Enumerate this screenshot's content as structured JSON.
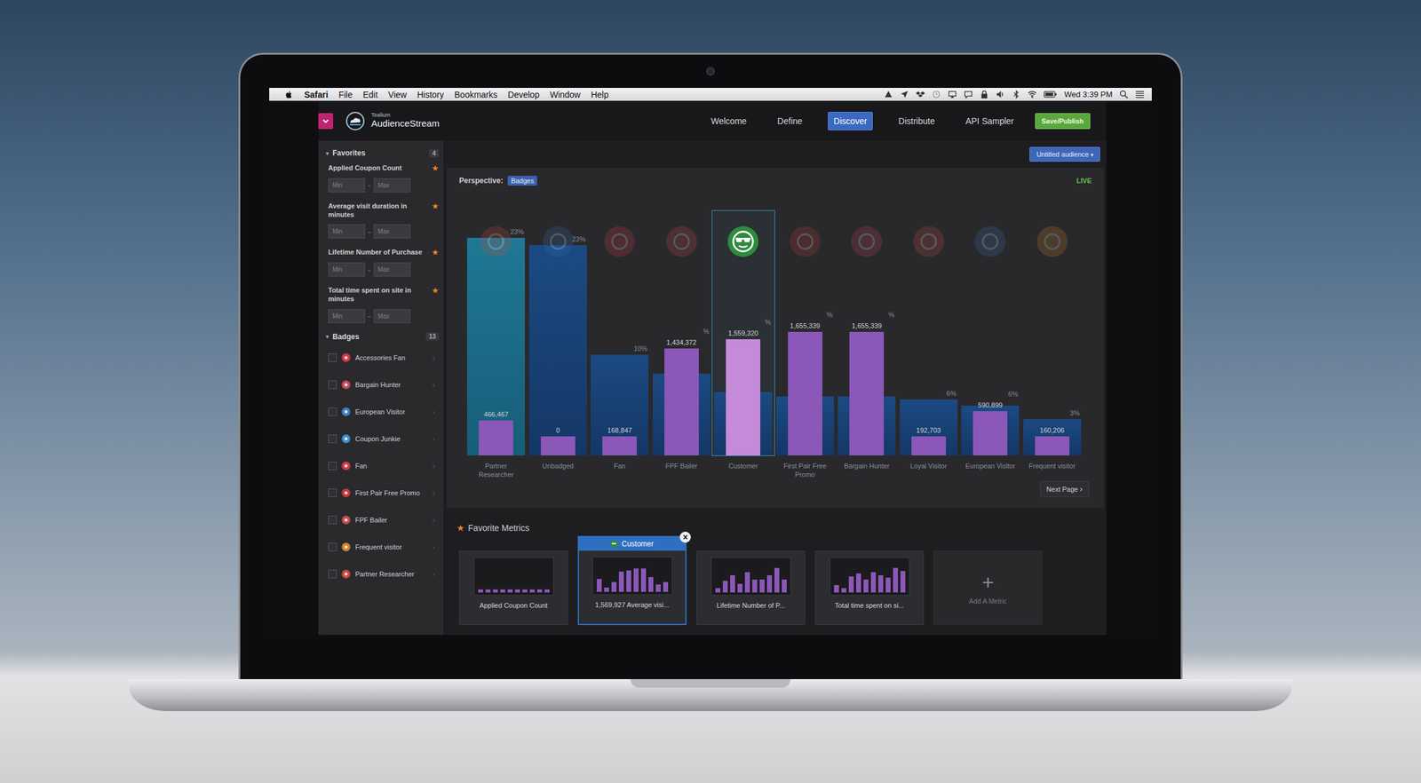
{
  "menubar": {
    "app": "Safari",
    "items": [
      "File",
      "Edit",
      "View",
      "History",
      "Bookmarks",
      "Develop",
      "Window",
      "Help"
    ],
    "clock": "Wed 3:39 PM"
  },
  "header": {
    "brand_small": "Tealium",
    "brand": "AudienceStream",
    "nav": [
      {
        "label": "Welcome",
        "selected": false
      },
      {
        "label": "Define",
        "selected": false
      },
      {
        "label": "Discover",
        "selected": true
      },
      {
        "label": "Distribute",
        "selected": false
      },
      {
        "label": "API Sampler",
        "selected": false
      }
    ],
    "publish": "Save/Publish"
  },
  "sidebar": {
    "favorites": {
      "toggle": "▾",
      "title": "Favorites",
      "count": "4",
      "expanded": true,
      "filters": [
        {
          "label": "Applied Coupon Count",
          "starred": true,
          "star": "★",
          "min": "Min",
          "separator": "-",
          "max": "Max"
        },
        {
          "label": "Average visit duration in minutes",
          "starred": true,
          "star": "★",
          "min": "Min",
          "separator": "-",
          "max": "Max"
        },
        {
          "label": "Lifetime Number of Purchase",
          "starred": true,
          "star": "★",
          "min": "Min",
          "separator": "-",
          "max": "Max"
        },
        {
          "label": "Total time spent on site in minutes",
          "starred": true,
          "star": "★",
          "min": "Min",
          "separator": "-",
          "max": "Max"
        }
      ]
    },
    "badges": {
      "toggle": "▾",
      "title": "Badges",
      "count": "13",
      "expanded": true,
      "chevron": "›",
      "items": [
        {
          "label": "Accessories Fan",
          "checked": false,
          "color": "#d2384a"
        },
        {
          "label": "Bargain Hunter",
          "checked": false,
          "color": "#c9475a"
        },
        {
          "label": "European Visitor",
          "checked": false,
          "color": "#3b7fc4"
        },
        {
          "label": "Coupon Junkie",
          "checked": false,
          "color": "#3b8fd0"
        },
        {
          "label": "Fan",
          "checked": false,
          "color": "#d03a4a"
        },
        {
          "label": "First Pair Free Promo",
          "checked": false,
          "color": "#c23a3a"
        },
        {
          "label": "FPF Bailer",
          "checked": false,
          "color": "#c84a4a"
        },
        {
          "label": "Frequent visitor",
          "checked": false,
          "color": "#d0822a"
        },
        {
          "label": "Partner Researcher",
          "checked": false,
          "color": "#c94a3c"
        }
      ]
    }
  },
  "toolbar": {
    "audience": "Untitled audience",
    "caret": "▾"
  },
  "chart": {
    "perspective_label": "Perspective:",
    "perspective": "Badges",
    "live": "LIVE",
    "columns": [
      {
        "label": "Partner Researcher",
        "value": 466467,
        "value_label": "466,467",
        "total": 2921000,
        "percent": "23%",
        "color": "#c94a3c",
        "selected": false,
        "hovered": true
      },
      {
        "label": "Unbadged",
        "value": 0,
        "value_label": "0",
        "total": 2824000,
        "percent": "23%",
        "color": "#2f6fb3",
        "selected": false,
        "hovered": false
      },
      {
        "label": "Fan",
        "value": 168847,
        "value_label": "168,847",
        "total": 1351000,
        "percent": "10%",
        "color": "#d03a4a",
        "selected": false,
        "hovered": false
      },
      {
        "label": "FPF Bailer",
        "value": 1434372,
        "value_label": "1,434,372",
        "total": 1095000,
        "percent": "%",
        "color": "#c84a4a",
        "selected": false,
        "hovered": false
      },
      {
        "label": "Customer",
        "value": 1559320,
        "value_label": "1,559,320",
        "total": 852000,
        "percent": "%",
        "color": "#2e8b3e",
        "selected": true,
        "hovered": false
      },
      {
        "label": "First Pair Free Promo",
        "value": 1655339,
        "value_label": "1,655,339",
        "total": 791000,
        "percent": "%",
        "color": "#c23a3a",
        "selected": false,
        "hovered": false
      },
      {
        "label": "Bargain Hunter",
        "value": 1655339,
        "value_label": "1,655,339",
        "total": 791000,
        "percent": "%",
        "color": "#c9475a",
        "selected": false,
        "hovered": false
      },
      {
        "label": "Loyal Visitor",
        "value": 192703,
        "value_label": "192,703",
        "total": 755000,
        "percent": "6%",
        "color": "#c8504a",
        "selected": false,
        "hovered": false
      },
      {
        "label": "European Visitor",
        "value": 590899,
        "value_label": "590,899",
        "total": 669000,
        "percent": "6%",
        "color": "#3b6fb0",
        "selected": false,
        "hovered": false
      },
      {
        "label": "Frequent visitor",
        "value": 160206,
        "value_label": "160,206",
        "total": 487000,
        "percent": "3%",
        "color": "#d0822a",
        "selected": false,
        "hovered": false
      }
    ],
    "next_page": "Next Page",
    "next_icon": "›"
  },
  "metrics": {
    "star": "★",
    "title": "Favorite Metrics",
    "cards": [
      {
        "label": "Applied Coupon Count",
        "selected": false,
        "bars": [
          2,
          2,
          2,
          2,
          2,
          2,
          2,
          2,
          2,
          2
        ]
      },
      {
        "label": "1,569,927 Average visi...",
        "selected": true,
        "tag": "Customer",
        "tag_color": "#2e8b3e",
        "close": "×",
        "bars": [
          9,
          3,
          7,
          14,
          15,
          16,
          16,
          10,
          5,
          7
        ]
      },
      {
        "label": "Lifetime Number of P...",
        "selected": false,
        "bars": [
          3,
          8,
          12,
          6,
          14,
          9,
          9,
          12,
          17,
          9
        ]
      },
      {
        "label": "Total time spent on si...",
        "selected": false,
        "bars": [
          5,
          3,
          11,
          13,
          9,
          14,
          12,
          10,
          17,
          15
        ]
      }
    ],
    "add": {
      "icon": "+",
      "label": "Add A Metric"
    }
  }
}
